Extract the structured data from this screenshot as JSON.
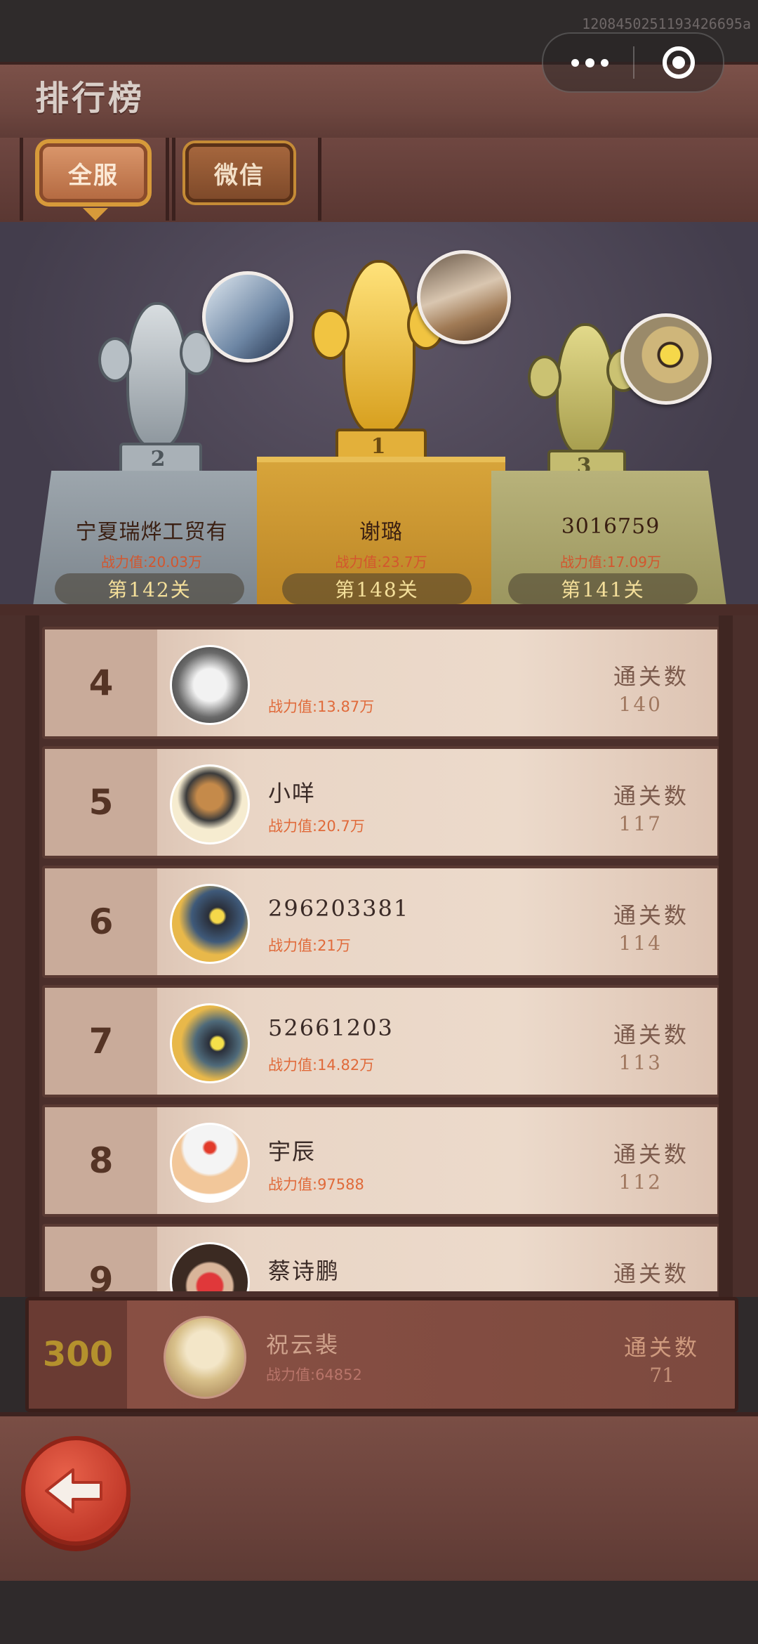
{
  "build_id": "1208450251193426695a",
  "header": {
    "title": "排行榜"
  },
  "tabs": [
    {
      "label": "全服",
      "active": true
    },
    {
      "label": "微信",
      "active": false
    }
  ],
  "podium": {
    "silver": {
      "rank": "2",
      "name": "宁夏瑞烨工贸有",
      "power": "战力值:20.03万",
      "level": "第142关"
    },
    "gold": {
      "rank": "1",
      "name": "谢璐",
      "power": "战力值:23.7万",
      "level": "第148关"
    },
    "bronze": {
      "rank": "3",
      "name": "3016759",
      "power": "战力值:17.09万",
      "level": "第141关"
    }
  },
  "list": [
    {
      "rank": "4",
      "name": "",
      "power": "战力值:13.87万",
      "count_label": "通关数",
      "count": "140",
      "avatar": "moon-autumn-icon"
    },
    {
      "rank": "5",
      "name": "小咩",
      "power": "战力值:20.7万",
      "count_label": "通关数",
      "count": "117",
      "avatar": "anime-boy-icon"
    },
    {
      "rank": "6",
      "name": "296203381",
      "power": "战力值:21万",
      "count_label": "通关数",
      "count": "114",
      "avatar": "cartoon-fish-icon"
    },
    {
      "rank": "7",
      "name": "52661203",
      "power": "战力值:14.82万",
      "count_label": "通关数",
      "count": "113",
      "avatar": "cartoon-fish-icon"
    },
    {
      "rank": "8",
      "name": "宇辰",
      "power": "战力值:97588",
      "count_label": "通关数",
      "count": "112",
      "avatar": "medic-helmet-icon"
    },
    {
      "rank": "9",
      "name": "蔡诗鹏",
      "power": "",
      "count_label": "通关数",
      "count": "",
      "avatar": "child-photo-icon"
    }
  ],
  "self": {
    "rank": "300",
    "name": "祝云裴",
    "power": "战力值:64852",
    "count_label": "通关数",
    "count": "71"
  },
  "colors": {
    "gold": "#d7a43a",
    "silver": "#9da6ad",
    "bronze": "#b8b27a",
    "plank": "#6d463f"
  }
}
